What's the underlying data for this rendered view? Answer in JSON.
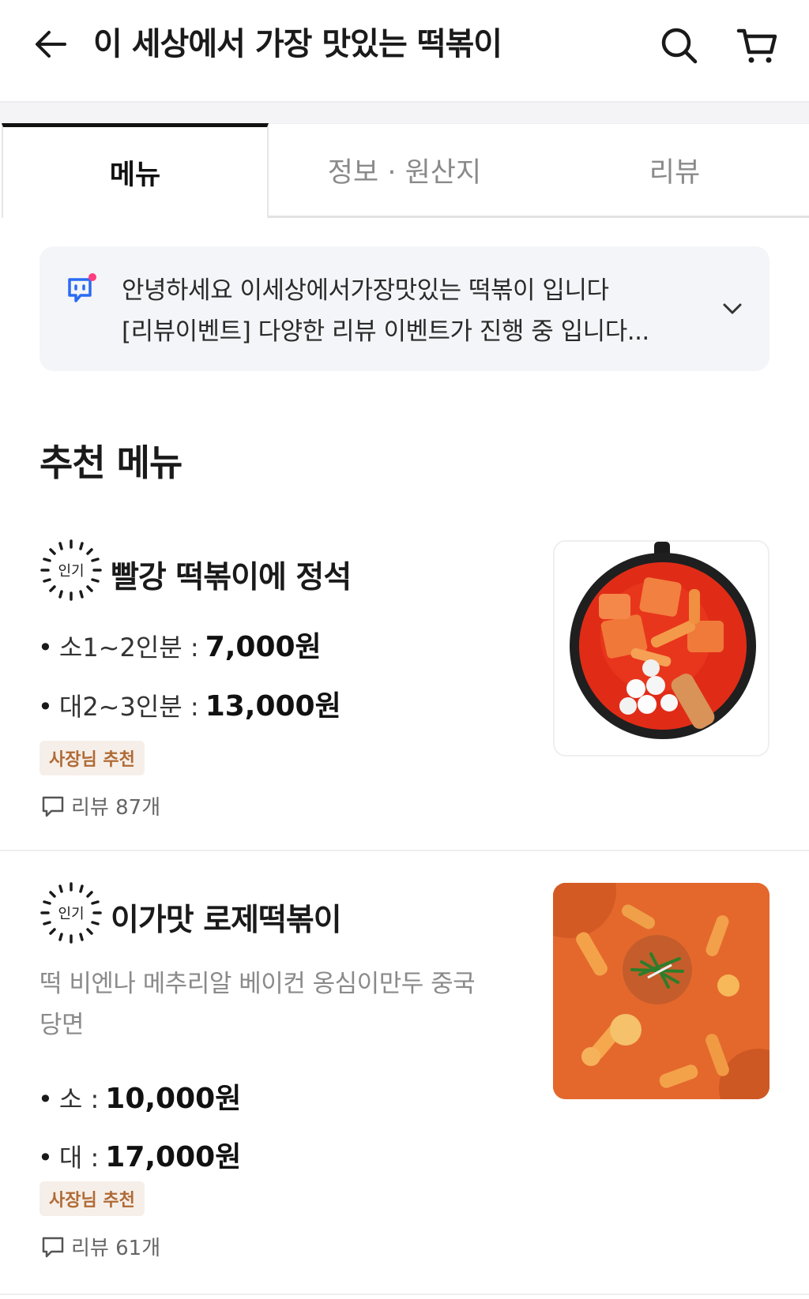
{
  "header": {
    "title": "이 세상에서 가장 맛있는 떡볶이",
    "back_icon": "arrow-left-icon",
    "search_icon": "search-icon",
    "cart_icon": "cart-icon"
  },
  "tabs": [
    {
      "label": "메뉴",
      "active": true
    },
    {
      "label": "정보 · 원산지",
      "active": false
    },
    {
      "label": "리뷰",
      "active": false
    }
  ],
  "notice": {
    "line1": "안녕하세요 이세상에서가장맛있는 떡볶이 입니다",
    "line2": "[리뷰이벤트] 다양한 리뷰 이벤트가 진행 중 입니다...",
    "icon": "speech-bubble-icon"
  },
  "section_title": "추천 메뉴",
  "items": [
    {
      "badge": "인기",
      "name": "빨강 떡볶이에 정석",
      "prices": [
        {
          "label": "소1~2인분 :",
          "value": "7,000원"
        },
        {
          "label": "대2~3인분 :",
          "value": "13,000원"
        }
      ],
      "tag": "사장님 추천",
      "reviews": "리뷰 87개"
    },
    {
      "badge": "인기",
      "name": "이가맛 로제떡볶이",
      "desc": "떡 비엔나 메추리알 베이컨 옹심이만두 중국당면",
      "prices": [
        {
          "label": "소 :",
          "value": "10,000원"
        },
        {
          "label": "대 :",
          "value": "17,000원"
        }
      ],
      "tag": "사장님 추천",
      "reviews": "리뷰 61개"
    }
  ],
  "colors": {
    "accent_icon_blue": "#2b6bf3",
    "notice_dot": "#ff3d7f",
    "tag_bg": "#f6efe9",
    "tag_text": "#b06a35",
    "muted_text": "#8a8a8a"
  }
}
